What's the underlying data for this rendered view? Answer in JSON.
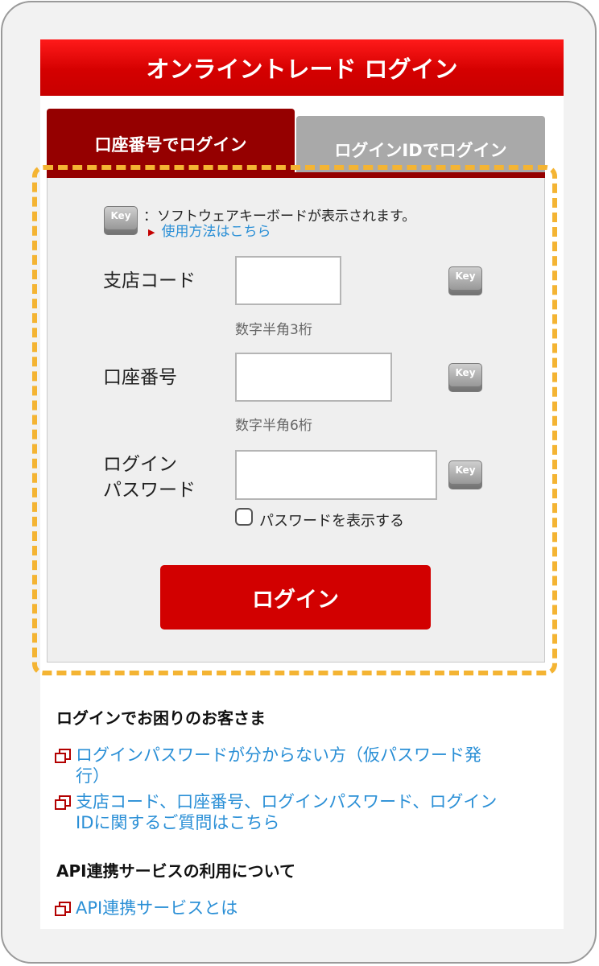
{
  "header": {
    "title": "オンライントレード ログイン"
  },
  "tabs": [
    {
      "label": "口座番号でログイン",
      "active": true
    },
    {
      "label": "ログインIDでログイン",
      "active": false
    }
  ],
  "keyboard_hint": {
    "key_label": "Key",
    "text": "：ソフトウェアキーボードが表示されます。",
    "link": "使用方法はこちら"
  },
  "form": {
    "branch_code": {
      "label": "支店コード",
      "value": "",
      "note": "数字半角3桁"
    },
    "account_number": {
      "label": "口座番号",
      "value": "",
      "note": "数字半角6桁"
    },
    "password": {
      "label_line1": "ログイン",
      "label_line2": "パスワード",
      "value": ""
    },
    "show_password": {
      "label": "パスワードを表示する",
      "checked": false
    },
    "submit_label": "ログイン"
  },
  "help": {
    "title": "ログインでお困りのお客さま",
    "links": [
      {
        "line1": "ログインパスワードが分からない方（仮パスワード発",
        "line2": "行）"
      },
      {
        "line1": "支店コード、口座番号、ログインパスワード、ログイン",
        "line2": "IDに関するご質問はこちら"
      }
    ]
  },
  "api": {
    "title": "API連携サービスの利用について",
    "link": "API連携サービスとは"
  },
  "colors": {
    "brand_red": "#d20000",
    "tab_dark": "#950000",
    "link_blue": "#2a8fd6",
    "highlight": "#f4b433"
  }
}
